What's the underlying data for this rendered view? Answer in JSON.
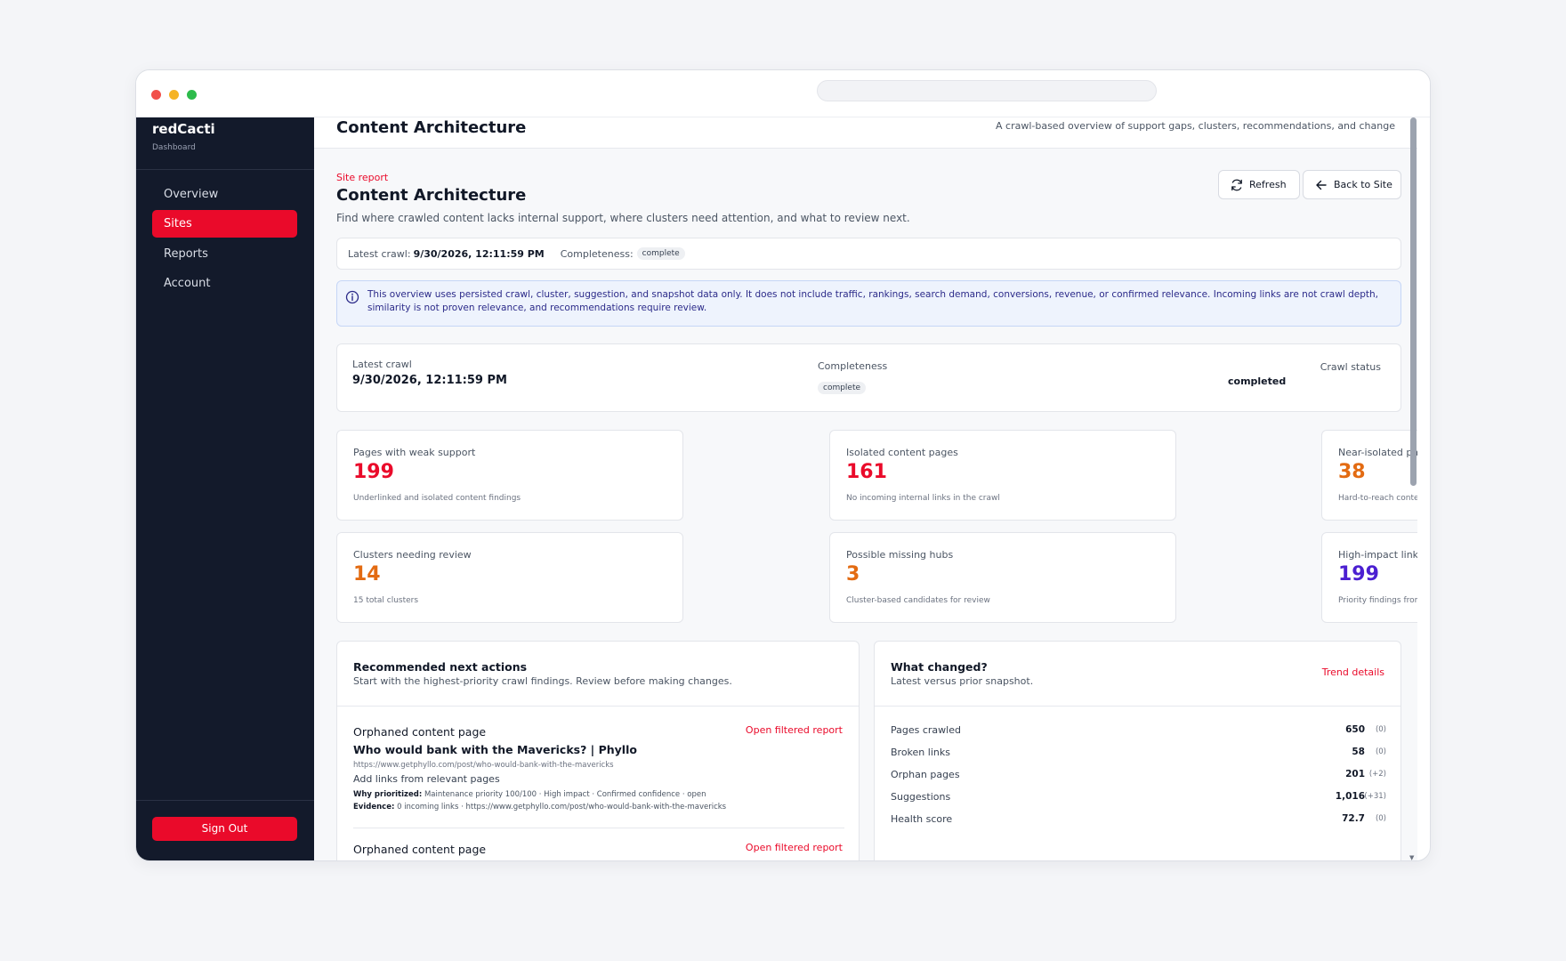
{
  "sidebar": {
    "brand": "redCacti",
    "brand_sub": "Dashboard",
    "items": [
      {
        "label": "Overview"
      },
      {
        "label": "Sites"
      },
      {
        "label": "Reports"
      },
      {
        "label": "Account"
      }
    ],
    "signout_label": "Sign Out"
  },
  "topbar": {
    "title": "Content Architecture",
    "subtitle": "A crawl-based overview of support gaps, clusters, recommendations, and change"
  },
  "header": {
    "eyebrow": "Site report",
    "title": "Content Architecture",
    "description": "Find where crawled content lacks internal support, where clusters need attention, and what to review next.",
    "refresh_label": "Refresh",
    "back_label": "Back to Site"
  },
  "crawlbar": {
    "latest_label": "Latest crawl:",
    "latest_value": "9/30/2026, 12:11:59 PM",
    "completeness_label": "Completeness:",
    "completeness_value": "complete"
  },
  "notice": "This overview uses persisted crawl, cluster, suggestion, and snapshot data only. It does not include traffic, rankings, search demand, conversions, revenue, or confirmed relevance. Incoming links are not crawl depth, similarity is not proven relevance, and recommendations require review.",
  "summary": {
    "latest_label": "Latest crawl",
    "latest_value": "9/30/2026, 12:11:59 PM",
    "completeness_label": "Completeness",
    "completeness_value": "complete",
    "status_label": "Crawl status",
    "status_value": "completed"
  },
  "stats": [
    {
      "label": "Pages with weak support",
      "value": "199",
      "sub": "Underlinked and isolated content findings"
    },
    {
      "label": "Isolated content pages",
      "value": "161",
      "sub": "No incoming internal links in the crawl"
    },
    {
      "label": "Near-isolated pages",
      "value": "38",
      "sub": "Hard-to-reach content with one incoming link"
    },
    {
      "label": "Clusters needing review",
      "value": "14",
      "sub": "15 total clusters"
    },
    {
      "label": "Possible missing hubs",
      "value": "3",
      "sub": "Cluster-based candidates for review"
    },
    {
      "label": "High-impact link opportunities",
      "value": "199",
      "sub": "Priority findings from the latest crawl"
    }
  ],
  "actions": {
    "title": "Recommended next actions",
    "subtitle": "Start with the highest-priority crawl findings. Review before making changes.",
    "items": [
      {
        "type": "Orphaned content page",
        "link": "Open filtered report",
        "title": "Who would bank with the Mavericks? | Phyllo",
        "url": "https://www.getphyllo.com/post/who-would-bank-with-the-mavericks",
        "action": "Add links from relevant pages",
        "why_label": "Why prioritized:",
        "why": "Maintenance priority 100/100 · High impact · Confirmed confidence · open",
        "evidence_label": "Evidence:",
        "evidence": "0 incoming links · https://www.getphyllo.com/post/who-would-bank-with-the-mavericks"
      },
      {
        "type": "Orphaned content page",
        "link": "Open filtered report"
      }
    ]
  },
  "changes": {
    "title": "What changed?",
    "subtitle": "Latest versus prior snapshot.",
    "link": "Trend details",
    "rows": [
      {
        "label": "Pages crawled",
        "value": "650",
        "delta": "(0)"
      },
      {
        "label": "Broken links",
        "value": "58",
        "delta": "(0)"
      },
      {
        "label": "Orphan pages",
        "value": "201",
        "delta": "(+2)"
      },
      {
        "label": "Suggestions",
        "value": "1,016",
        "delta": "(+31)"
      },
      {
        "label": "Health score",
        "value": "72.7",
        "delta": "(0)"
      }
    ]
  },
  "colors": {
    "accent": "#ea0a2a",
    "sidebar_bg": "#131a2b",
    "orange": "#e36b12",
    "purple": "#4b1fd1"
  }
}
